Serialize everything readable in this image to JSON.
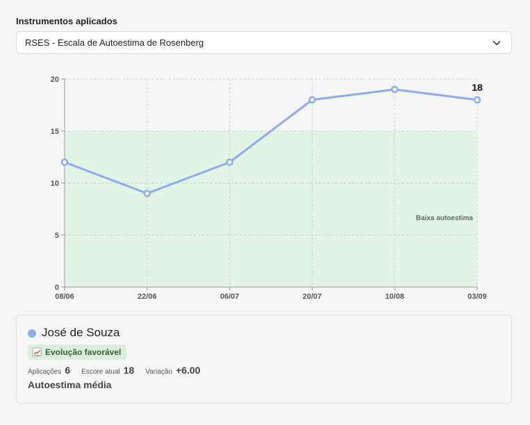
{
  "section_title": "Instrumentos aplicados",
  "instrument_select": {
    "value": "RSES - Escala de Autoestima de Rosenberg",
    "icon": "chevron-down-icon"
  },
  "chart_data": {
    "type": "line",
    "categories": [
      "08/06",
      "22/06",
      "06/07",
      "20/07",
      "10/08",
      "03/09"
    ],
    "series": [
      {
        "values": [
          12,
          9,
          12,
          18,
          19,
          18
        ],
        "color": "#8eaaf0"
      }
    ],
    "ylim": [
      0,
      20
    ],
    "yticks": [
      0,
      5,
      10,
      15,
      20
    ],
    "grid": true,
    "last_value_label": "18",
    "bands": [
      {
        "from": 0,
        "to": 15,
        "label": "Baixa autoestima",
        "color": "#e2f4e4"
      }
    ]
  },
  "patient_card": {
    "name": "José de Souza",
    "marker_color": "#8eaaf0",
    "badge": {
      "label": "Evolução favorável",
      "icon": "trending-up-icon"
    },
    "stats": {
      "applications_label": "Aplicações",
      "applications_value": "6",
      "current_label": "Escore atual",
      "current_value": "18",
      "variation_label": "Variação",
      "variation_value": "+6.00"
    },
    "level": "Autoestima média"
  }
}
